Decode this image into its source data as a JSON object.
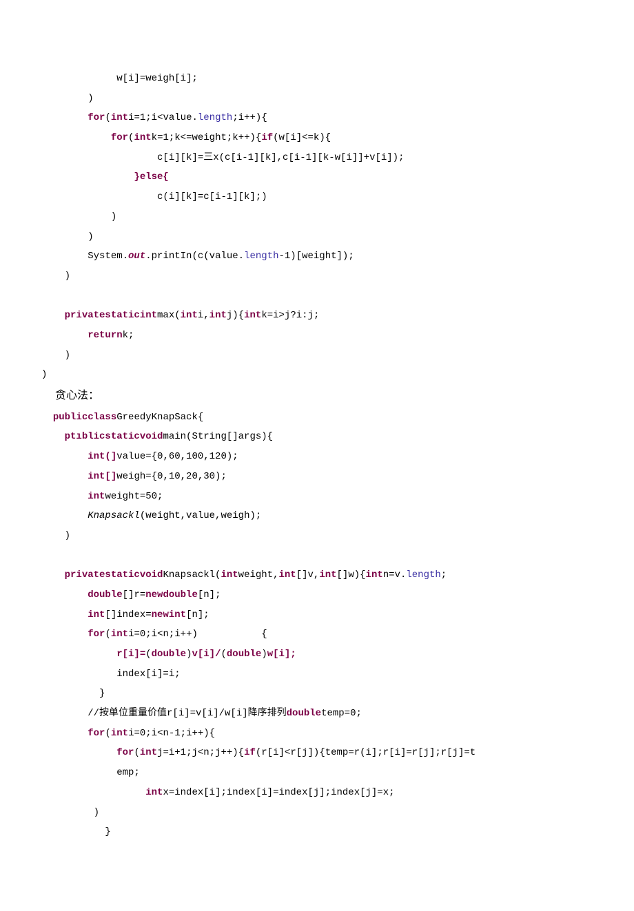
{
  "lines": [
    {
      "segs": [
        {
          "t": "             w[i]=weigh[i];"
        }
      ]
    },
    {
      "segs": [
        {
          "t": "        )"
        }
      ]
    },
    {
      "segs": [
        {
          "t": "        "
        },
        {
          "t": "for",
          "c": "kw"
        },
        {
          "t": "("
        },
        {
          "t": "int",
          "c": "kw"
        },
        {
          "t": "i=1;i<value."
        },
        {
          "t": "length",
          "c": "field"
        },
        {
          "t": ";i++){"
        }
      ]
    },
    {
      "segs": [
        {
          "t": "            "
        },
        {
          "t": "for",
          "c": "kw"
        },
        {
          "t": "("
        },
        {
          "t": "int",
          "c": "kw"
        },
        {
          "t": "k=1;k<=weight;k++){"
        },
        {
          "t": "if",
          "c": "kw"
        },
        {
          "t": "(w[i]<=k){"
        }
      ]
    },
    {
      "segs": [
        {
          "t": "                    c[i][k]=三x(c[i-1][k],c[i-1][k-w[i]]+v[i]);"
        }
      ]
    },
    {
      "segs": [
        {
          "t": "                "
        },
        {
          "t": "}else{",
          "c": "kw"
        }
      ]
    },
    {
      "segs": [
        {
          "t": "                    c(i][k]=c[i-1][k];)"
        }
      ]
    },
    {
      "segs": [
        {
          "t": "            )"
        }
      ]
    },
    {
      "segs": [
        {
          "t": "        )"
        }
      ]
    },
    {
      "segs": [
        {
          "t": "        System."
        },
        {
          "t": "out",
          "c": "kw ident"
        },
        {
          "t": ".printIn(c(value."
        },
        {
          "t": "length",
          "c": "field"
        },
        {
          "t": "-1)[weight]);"
        }
      ]
    },
    {
      "segs": [
        {
          "t": "    )"
        }
      ]
    },
    {
      "segs": [
        {
          "t": " "
        }
      ]
    },
    {
      "segs": [
        {
          "t": "    "
        },
        {
          "t": "privatestaticint",
          "c": "kw"
        },
        {
          "t": "max("
        },
        {
          "t": "int",
          "c": "kw"
        },
        {
          "t": "i,"
        },
        {
          "t": "int",
          "c": "kw"
        },
        {
          "t": "j){"
        },
        {
          "t": "int",
          "c": "kw"
        },
        {
          "t": "k=i>j?i:j;"
        }
      ]
    },
    {
      "segs": [
        {
          "t": "        "
        },
        {
          "t": "return",
          "c": "kw"
        },
        {
          "t": "k;"
        }
      ]
    },
    {
      "segs": [
        {
          "t": "    )"
        }
      ]
    },
    {
      "segs": [
        {
          "t": ")"
        }
      ]
    }
  ],
  "title": "     贪心法：",
  "lines2": [
    {
      "segs": [
        {
          "t": "  "
        },
        {
          "t": "publicclass",
          "c": "kw"
        },
        {
          "t": "GreedyKnapSack{"
        }
      ]
    },
    {
      "segs": [
        {
          "t": "    "
        },
        {
          "t": "ptıblicstaticvoid",
          "c": "kw"
        },
        {
          "t": "main(String[]args){"
        }
      ]
    },
    {
      "segs": [
        {
          "t": "        "
        },
        {
          "t": "int(]",
          "c": "kw"
        },
        {
          "t": "value={0,60,100,120);"
        }
      ]
    },
    {
      "segs": [
        {
          "t": "        "
        },
        {
          "t": "int[]",
          "c": "kw"
        },
        {
          "t": "weigh={0,10,20,30);"
        }
      ]
    },
    {
      "segs": [
        {
          "t": "        "
        },
        {
          "t": "int",
          "c": "kw"
        },
        {
          "t": "weight=50;"
        }
      ]
    },
    {
      "segs": [
        {
          "t": "        "
        },
        {
          "t": "Knapsackl",
          "c": "ident"
        },
        {
          "t": "(weight,value,weigh);"
        }
      ]
    },
    {
      "segs": [
        {
          "t": "    )"
        }
      ]
    },
    {
      "segs": [
        {
          "t": " "
        }
      ]
    },
    {
      "segs": [
        {
          "t": "    "
        },
        {
          "t": "privatestaticvoid",
          "c": "kw"
        },
        {
          "t": "Knapsackl("
        },
        {
          "t": "int",
          "c": "kw"
        },
        {
          "t": "weight,"
        },
        {
          "t": "int",
          "c": "kw"
        },
        {
          "t": "[]v,"
        },
        {
          "t": "int",
          "c": "kw"
        },
        {
          "t": "[]w){"
        },
        {
          "t": "int",
          "c": "kw"
        },
        {
          "t": "n=v."
        },
        {
          "t": "length",
          "c": "field"
        },
        {
          "t": ";"
        }
      ]
    },
    {
      "segs": [
        {
          "t": "        "
        },
        {
          "t": "double",
          "c": "kw"
        },
        {
          "t": "[]r="
        },
        {
          "t": "newdouble",
          "c": "kw"
        },
        {
          "t": "[n];"
        }
      ]
    },
    {
      "segs": [
        {
          "t": "        "
        },
        {
          "t": "int",
          "c": "kw"
        },
        {
          "t": "[]index="
        },
        {
          "t": "newint",
          "c": "kw"
        },
        {
          "t": "[n];"
        }
      ]
    },
    {
      "segs": [
        {
          "t": "        "
        },
        {
          "t": "for",
          "c": "kw"
        },
        {
          "t": "("
        },
        {
          "t": "int",
          "c": "kw"
        },
        {
          "t": "i=0;i<n;i++)           {"
        }
      ]
    },
    {
      "segs": [
        {
          "t": "             "
        },
        {
          "t": "r[i]=",
          "c": "kw"
        },
        {
          "t": "("
        },
        {
          "t": "double",
          "c": "kw"
        },
        {
          "t": ")"
        },
        {
          "t": "v[i]/",
          "c": "kw"
        },
        {
          "t": "("
        },
        {
          "t": "double",
          "c": "kw"
        },
        {
          "t": ")"
        },
        {
          "t": "w[i];",
          "c": "kw"
        }
      ]
    },
    {
      "segs": [
        {
          "t": "             index[i]=i;"
        }
      ]
    },
    {
      "segs": [
        {
          "t": "          }"
        }
      ]
    },
    {
      "segs": [
        {
          "t": "        //按单位重量价值r[i]=v[i]/w[i]降序排列"
        },
        {
          "t": "double",
          "c": "kw"
        },
        {
          "t": "temp=0;"
        }
      ]
    },
    {
      "segs": [
        {
          "t": "        "
        },
        {
          "t": "for",
          "c": "kw"
        },
        {
          "t": "("
        },
        {
          "t": "int",
          "c": "kw"
        },
        {
          "t": "i=0;i<n-1;i++){"
        }
      ]
    },
    {
      "segs": [
        {
          "t": "             "
        },
        {
          "t": "for",
          "c": "kw"
        },
        {
          "t": "("
        },
        {
          "t": "int",
          "c": "kw"
        },
        {
          "t": "j=i+1;j<n;j++){"
        },
        {
          "t": "if",
          "c": "kw"
        },
        {
          "t": "(r[i]<r[j]){temp=r(i];r[i]=r[j];r[j]=t"
        }
      ]
    },
    {
      "segs": [
        {
          "t": "             emp;"
        }
      ]
    },
    {
      "segs": [
        {
          "t": "                  "
        },
        {
          "t": "int",
          "c": "kw"
        },
        {
          "t": "x=index[i];index[i]=index[j];index[j]=x;"
        }
      ]
    },
    {
      "segs": [
        {
          "t": "         )"
        }
      ]
    },
    {
      "segs": [
        {
          "t": "           }"
        }
      ]
    }
  ]
}
